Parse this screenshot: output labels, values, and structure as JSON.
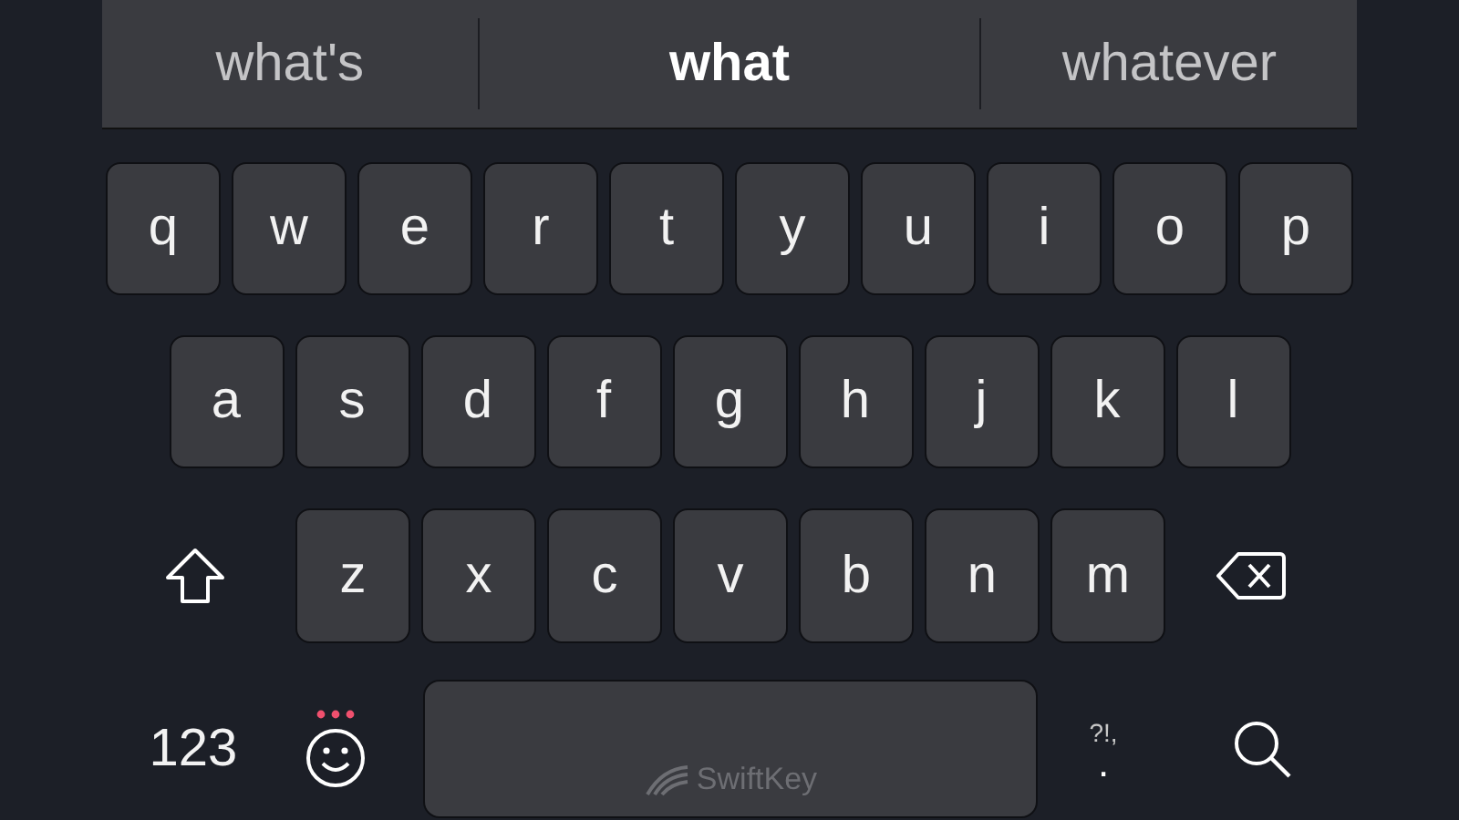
{
  "suggestions": [
    {
      "text": "what's",
      "selected": false
    },
    {
      "text": "what",
      "selected": true
    },
    {
      "text": "whatever",
      "selected": false
    }
  ],
  "rows": [
    [
      {
        "kind": "letter",
        "text": "q"
      },
      {
        "kind": "letter",
        "text": "w"
      },
      {
        "kind": "letter",
        "text": "e"
      },
      {
        "kind": "letter",
        "text": "r"
      },
      {
        "kind": "letter",
        "text": "t"
      },
      {
        "kind": "letter",
        "text": "y"
      },
      {
        "kind": "letter",
        "text": "u"
      },
      {
        "kind": "letter",
        "text": "i"
      },
      {
        "kind": "letter",
        "text": "o"
      },
      {
        "kind": "letter",
        "text": "p"
      }
    ],
    [
      {
        "kind": "letter",
        "text": "a"
      },
      {
        "kind": "letter",
        "text": "s"
      },
      {
        "kind": "letter",
        "text": "d"
      },
      {
        "kind": "letter",
        "text": "f"
      },
      {
        "kind": "letter",
        "text": "g"
      },
      {
        "kind": "letter",
        "text": "h"
      },
      {
        "kind": "letter",
        "text": "j"
      },
      {
        "kind": "letter",
        "text": "k"
      },
      {
        "kind": "letter",
        "text": "l"
      }
    ],
    [
      {
        "kind": "shift"
      },
      {
        "kind": "letter",
        "text": "z"
      },
      {
        "kind": "letter",
        "text": "x"
      },
      {
        "kind": "letter",
        "text": "c"
      },
      {
        "kind": "letter",
        "text": "v"
      },
      {
        "kind": "letter",
        "text": "b"
      },
      {
        "kind": "letter",
        "text": "n"
      },
      {
        "kind": "letter",
        "text": "m"
      },
      {
        "kind": "backspace"
      }
    ],
    [
      {
        "kind": "numbers",
        "text": "123"
      },
      {
        "kind": "emoji"
      },
      {
        "kind": "space",
        "text": "SwiftKey"
      },
      {
        "kind": "punct",
        "text": "?!,",
        "sub": "."
      },
      {
        "kind": "search"
      }
    ]
  ]
}
